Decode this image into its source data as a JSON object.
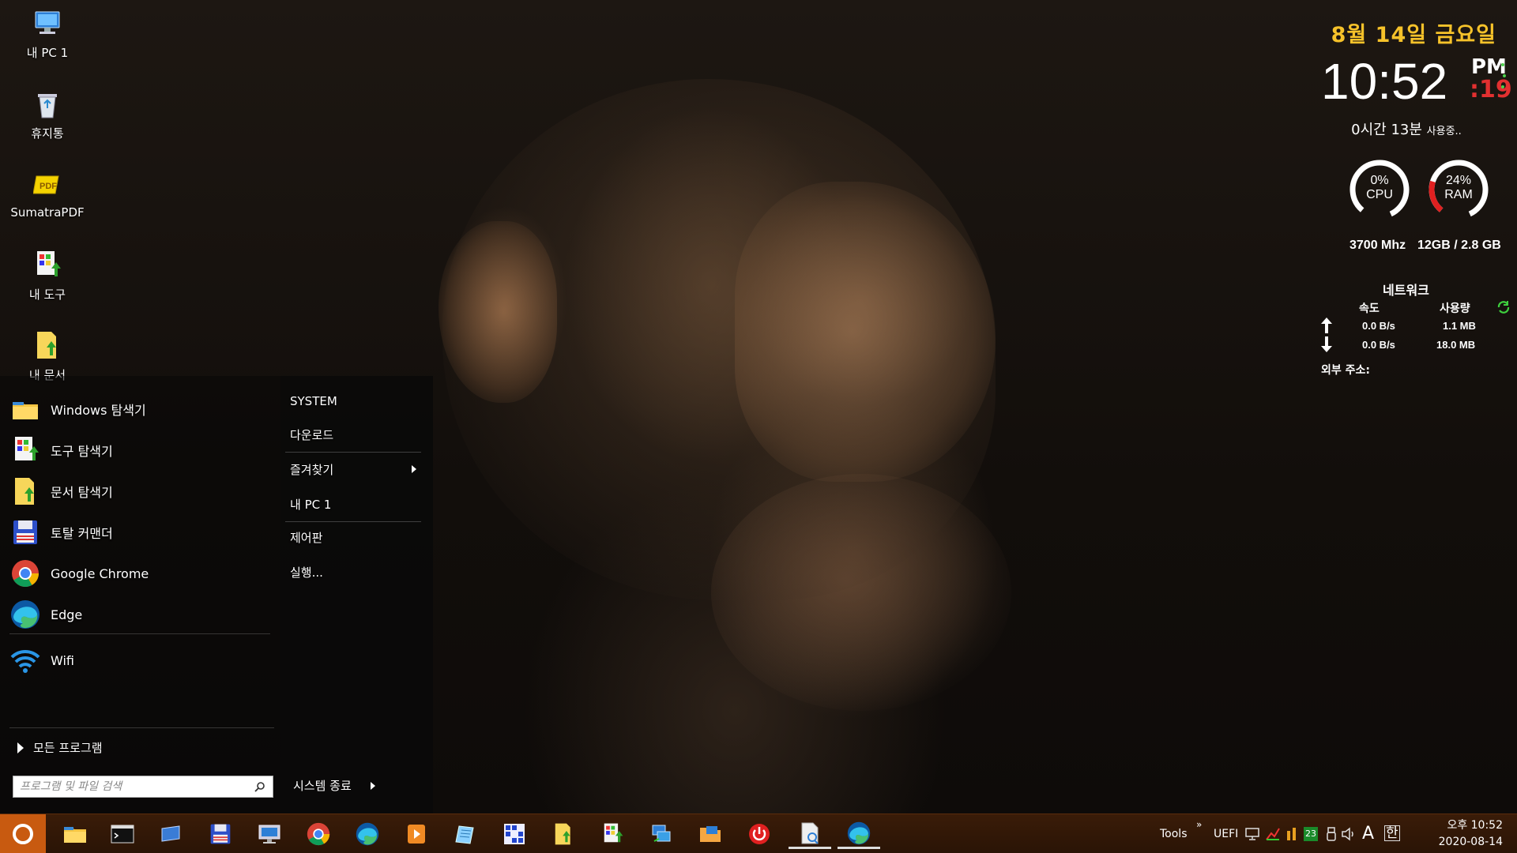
{
  "desktop": {
    "icons": [
      {
        "label": "내 PC 1",
        "icon": "computer-icon"
      },
      {
        "label": "휴지통",
        "icon": "recycle-bin-icon"
      },
      {
        "label": "SumatraPDF",
        "icon": "pdf-icon"
      },
      {
        "label": "내 도구",
        "icon": "tools-icon"
      },
      {
        "label": "내 문서",
        "icon": "documents-icon"
      }
    ]
  },
  "start_menu": {
    "items": [
      {
        "label": "Windows 탐색기",
        "icon": "folder-icon"
      },
      {
        "label": "도구 탐색기",
        "icon": "tools-explorer-icon"
      },
      {
        "label": "문서 탐색기",
        "icon": "document-explorer-icon"
      },
      {
        "label": "토탈 커맨더",
        "icon": "floppy-icon"
      },
      {
        "label": "Google Chrome",
        "icon": "chrome-icon"
      },
      {
        "label": "Edge",
        "icon": "edge-icon"
      },
      {
        "label": "Wifi",
        "icon": "wifi-icon"
      }
    ],
    "all_programs": "모든 프로그램",
    "search_placeholder": "프로그램 및 파일 검색",
    "right_items": [
      "SYSTEM",
      "다운로드",
      "즐겨찾기",
      "내 PC 1",
      "제어판",
      "실행..."
    ],
    "shutdown": "시스템 종료"
  },
  "widget": {
    "date": "8월 14일 금요일",
    "time": "10:52",
    "ampm": "PM",
    "seconds": ":19",
    "uptime": "0시간 13분",
    "uptime_suffix": "사용중..",
    "cpu": {
      "percent_label": "0%",
      "name": "CPU",
      "percent": 0,
      "sub": "3700 Mhz",
      "color": "#ffffff"
    },
    "ram": {
      "percent_label": "24%",
      "name": "RAM",
      "percent": 24,
      "sub": "12GB / 2.8 GB",
      "color": "#e02020"
    },
    "network": {
      "title": "네트워크",
      "speed_header": "속도",
      "usage_header": "사용량",
      "up_speed": "0.0 B/s",
      "up_usage": "1.1 MB",
      "down_speed": "0.0 B/s",
      "down_usage": "18.0 MB",
      "external_label": "외부 주소:"
    }
  },
  "taskbar": {
    "apps": [
      "file-explorer-icon",
      "cmd-icon",
      "display-icon",
      "floppy-icon",
      "remote-desktop-icon",
      "chrome-icon",
      "edge-icon",
      "media-player-icon",
      "notepad-icon",
      "registry-icon",
      "document-explorer-icon",
      "tools-explorer-icon",
      "network-icon",
      "folder-network-icon",
      "power-icon",
      "file-search-icon",
      "edge-active-icon"
    ],
    "tools_label": "Tools",
    "tools_chevron": "»",
    "uefi_label": "UEFI",
    "tray_number": "23",
    "ime_a": "A",
    "ime_han": "한",
    "clock_time": "오후 10:52",
    "clock_date": "2020-08-14"
  },
  "colors": {
    "accent_orange": "#c85a10",
    "date_yellow": "#f6c22a",
    "seconds_red": "#e23030"
  }
}
